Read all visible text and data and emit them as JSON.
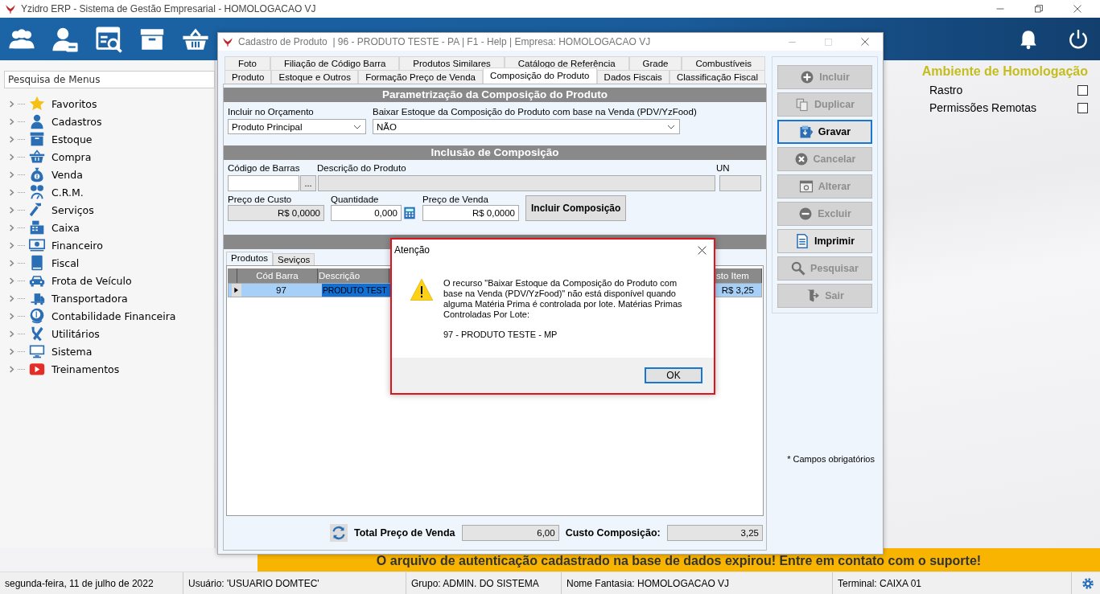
{
  "app": {
    "title": "Yzidro ERP - Sistema de Gestão Empresarial - HOMOLOGACAO VJ"
  },
  "sidebar": {
    "search": {
      "placeholder": "Pesquisa de Menus"
    },
    "items": [
      {
        "label": "Favoritos",
        "expanded": false
      },
      {
        "label": "Cadastros",
        "expanded": false
      },
      {
        "label": "Estoque",
        "expanded": false
      },
      {
        "label": "Compra",
        "expanded": false
      },
      {
        "label": "Venda",
        "expanded": false
      },
      {
        "label": "C.R.M.",
        "expanded": false
      },
      {
        "label": "Serviços",
        "expanded": false
      },
      {
        "label": "Caixa",
        "expanded": false
      },
      {
        "label": "Financeiro",
        "expanded": false
      },
      {
        "label": "Fiscal",
        "expanded": false
      },
      {
        "label": "Frota de Veículo",
        "expanded": false
      },
      {
        "label": "Transportadora",
        "expanded": false
      },
      {
        "label": "Contabilidade Financeira",
        "expanded": false
      },
      {
        "label": "Utilitários",
        "expanded": false
      },
      {
        "label": "Sistema",
        "expanded": false
      },
      {
        "label": "Treinamentos",
        "expanded": false
      }
    ]
  },
  "environment": {
    "title": "Ambiente de Homologação",
    "options": [
      {
        "label": "Rastro",
        "checked": false
      },
      {
        "label": "Permissões Remotas",
        "checked": false
      }
    ]
  },
  "product_window": {
    "title": "Cadastro de Produto  | 96 - PRODUTO TESTE - PA | F1 - Help | Empresa: HOMOLOGACAO VJ",
    "tab_rows": [
      [
        {
          "label": "Foto",
          "selected": false
        },
        {
          "label": "Filiação de Código Barra",
          "selected": false
        },
        {
          "label": "Produtos Similares",
          "selected": false
        },
        {
          "label": "Catálogo de Referência",
          "selected": false
        },
        {
          "label": "Grade",
          "selected": false
        },
        {
          "label": "Combustíveis",
          "selected": false
        }
      ],
      [
        {
          "label": "Produto",
          "selected": false
        },
        {
          "label": "Estoque e Outros",
          "selected": false
        },
        {
          "label": "Formação Preço de Venda",
          "selected": false
        },
        {
          "label": "Composição do Produto",
          "selected": true
        },
        {
          "label": "Dados Fiscais",
          "selected": false
        },
        {
          "label": "Classificação Fiscal",
          "selected": false
        }
      ]
    ],
    "parametrization": {
      "title": "Parametrização da Composição do Produto",
      "fields": [
        {
          "label": "Incluir no Orçamento",
          "value": "Produto Principal"
        },
        {
          "label": "Baixar Estoque da Composição do Produto com base na Venda (PDV/YzFood)",
          "value": "NÃO"
        }
      ]
    },
    "inclusion": {
      "title": "Inclusão de Composição",
      "barcode": {
        "label": "Código de Barras",
        "lookup": "...",
        "disabled": false
      },
      "description": {
        "label": "Descrição do Produto",
        "disabled": true
      },
      "unit": {
        "label": "UN",
        "disabled": true
      },
      "cost": {
        "label": "Preço de Custo",
        "value": "R$ 0,0000",
        "disabled": true
      },
      "quantity": {
        "label": "Quantidade",
        "value": "0,000",
        "disabled": false
      },
      "price": {
        "label": "Preço de Venda",
        "value": "R$ 0,0000",
        "disabled": false
      },
      "button": "Incluir Composição"
    },
    "sub_tabs": [
      {
        "label": "Produtos",
        "selected": true
      },
      {
        "label": "Seviços",
        "selected": false
      }
    ],
    "grid": {
      "columns": [
        "Cód Barra",
        "Descrição",
        "sto Item"
      ],
      "rows": [
        {
          "cells": [
            "97",
            "PRODUTO TEST",
            "R$ 3,25"
          ],
          "selected": true
        }
      ]
    },
    "totals": [
      {
        "label": "Total Preço de Venda",
        "value": "6,00"
      },
      {
        "label": "Custo Composição:",
        "value": "3,25"
      }
    ],
    "buttons": [
      {
        "label": "Incluir",
        "disabled": true,
        "focused": false
      },
      {
        "label": "Duplicar",
        "disabled": true,
        "focused": false
      },
      {
        "label": "Gravar",
        "disabled": false,
        "focused": true
      },
      {
        "label": "Cancelar",
        "disabled": true,
        "focused": false
      },
      {
        "label": "Alterar",
        "disabled": true,
        "focused": false
      },
      {
        "label": "Excluir",
        "disabled": true,
        "focused": false
      },
      {
        "label": "Imprimir",
        "disabled": false,
        "focused": false
      },
      {
        "label": "Pesquisar",
        "disabled": true,
        "focused": false
      },
      {
        "label": "Sair",
        "disabled": true,
        "focused": false
      }
    ],
    "note": "* Campos obrigatórios"
  },
  "dialog": {
    "title": "Atenção",
    "message": "O recurso \"Baixar Estoque da Composição do Produto com base na Venda (PDV/YzFood)\" não está disponível quando alguma Matéria Prima é controlada por lote. Matérias Primas Controladas Por Lote:",
    "detail": "97 - PRODUTO TESTE - MP",
    "button": "OK"
  },
  "banner": "O arquivo de autenticação cadastrado na base de dados expirou! Entre em contato com o suporte!",
  "status_bar": [
    "segunda-feira, 11 de julho de 2022",
    "Usuário: 'USUARIO DOMTEC'",
    "Grupo: ADMIN. DO SISTEMA",
    "Nome Fantasia: HOMOLOGACAO VJ",
    "Terminal: CAIXA 01"
  ]
}
